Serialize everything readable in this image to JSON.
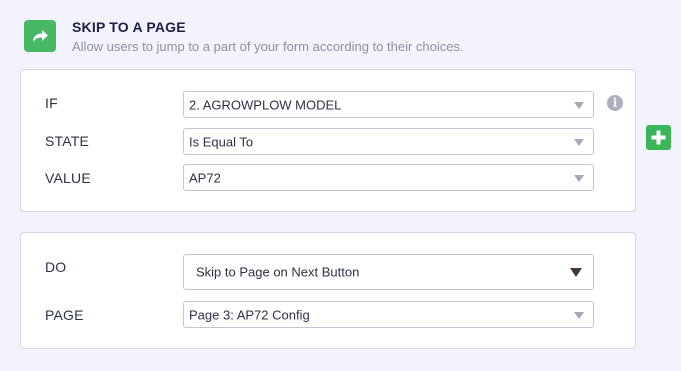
{
  "header": {
    "icon": "share-arrow-icon",
    "title": "SKIP TO A PAGE",
    "description": "Allow users to jump to a part of your form according to their choices."
  },
  "condition": {
    "if_label": "IF",
    "if_value": "2. AGROWPLOW MODEL",
    "state_label": "STATE",
    "state_value": "Is Equal To",
    "value_label": "VALUE",
    "value_value": "AP72"
  },
  "action": {
    "do_label": "DO",
    "do_value": "Skip to Page on Next Button",
    "page_label": "PAGE",
    "page_value": "Page 3: AP72 Config"
  },
  "icons": {
    "info": "info-icon",
    "add": "plus-icon"
  },
  "colors": {
    "accent_green": "#47b863",
    "add_green": "#3ab659",
    "background": "#f3f3fe",
    "card_border": "#d6d8e6"
  }
}
